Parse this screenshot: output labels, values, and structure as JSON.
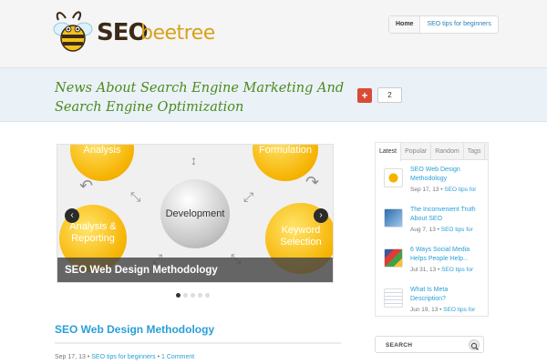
{
  "header": {
    "logo": {
      "word1": "SEO",
      "word2": "beetree"
    },
    "nav": [
      {
        "label": "Home",
        "active": true
      },
      {
        "label": "SEO tips for beginners",
        "active": false
      }
    ]
  },
  "tagline": {
    "line1": "News About Search Engine Marketing And",
    "line2": "Search Engine Optimization"
  },
  "share": {
    "icon": "google-plus-icon",
    "symbol": "+",
    "count": "2"
  },
  "slider": {
    "caption": "SEO Web Design Methodology",
    "nodes": {
      "top_left": "Analysis",
      "top_right": "Formulation",
      "center": "Development",
      "bottom_left_line1": "Analysis &",
      "bottom_left_line2": "Reporting",
      "bottom_right_line1": "Keyword",
      "bottom_right_line2": "Selection"
    },
    "prev_symbol": "‹",
    "next_symbol": "›",
    "slide_count": 5,
    "active_slide": 1
  },
  "post": {
    "title": "SEO Web Design Methodology",
    "date": "Sep 17, 13",
    "category": "SEO tips for beginners",
    "comments": "1 Comment",
    "separator": "•"
  },
  "sidebar": {
    "tabs": [
      "Latest",
      "Popular",
      "Random",
      "Tags"
    ],
    "active_tab": "Latest",
    "items": [
      {
        "title_line1": "SEO Web Design",
        "title_line2": "Methodology",
        "date": "Sep 17, 13",
        "category": "SEO tips for"
      },
      {
        "title_line1": "The Inconvenient Truth",
        "title_line2": "About SEO",
        "date": "Aug 7, 13",
        "category": "SEO tips for"
      },
      {
        "title_line1": "6 Ways Social Media",
        "title_line2": "Helps People Help...",
        "date": "Jul 31, 13",
        "category": "SEO tips for"
      },
      {
        "title_line1": "What Is Meta",
        "title_line2": "Description?",
        "date": "Jun 19, 13",
        "category": "SEO tips for"
      }
    ]
  },
  "search": {
    "label": "SEARCH",
    "icon": "search-icon"
  },
  "colors": {
    "link": "#2a9fd6",
    "tagline": "#4c8a1c",
    "google_plus": "#d94b36"
  }
}
